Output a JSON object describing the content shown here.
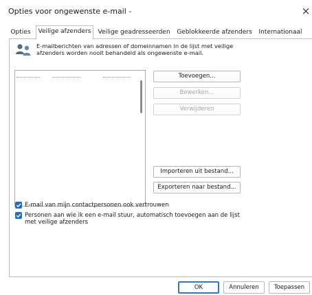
{
  "window": {
    "title": "Opties voor ongewenste e-mail -",
    "close_glyph": "×"
  },
  "tabs": [
    {
      "label": "Opties",
      "active": false
    },
    {
      "label": "Veilige afzenders",
      "active": true
    },
    {
      "label": "Veilige geadresseerden",
      "active": false
    },
    {
      "label": "Geblokkeerde afzenders",
      "active": false
    },
    {
      "label": "Internationaal",
      "active": false
    }
  ],
  "header": {
    "icon": "people-icon",
    "text": "E-mailberichten van adressen of domeinnamen in de lijst met veilige afzenders worden nooit behandeld als ongewenste e-mail."
  },
  "buttons": {
    "add": "Toevoegen...",
    "edit": "Bewerken...",
    "remove": "Verwijderen",
    "import": "Importeren uit bestand...",
    "export": "Exporteren naar bestand..."
  },
  "checkboxes": [
    {
      "label": "E-mail van mijn contactpersonen ook vertrouwen",
      "checked": true
    },
    {
      "label": "Personen aan wie ik een e-mail stuur, automatisch toevoegen aan de lijst met veilige afzenders",
      "checked": true
    }
  ],
  "footer": {
    "ok": "OK",
    "cancel": "Annuleren",
    "apply": "Toepassen"
  },
  "colors": {
    "accent": "#1f6fc4",
    "people_icon": "#4a6b8c"
  }
}
